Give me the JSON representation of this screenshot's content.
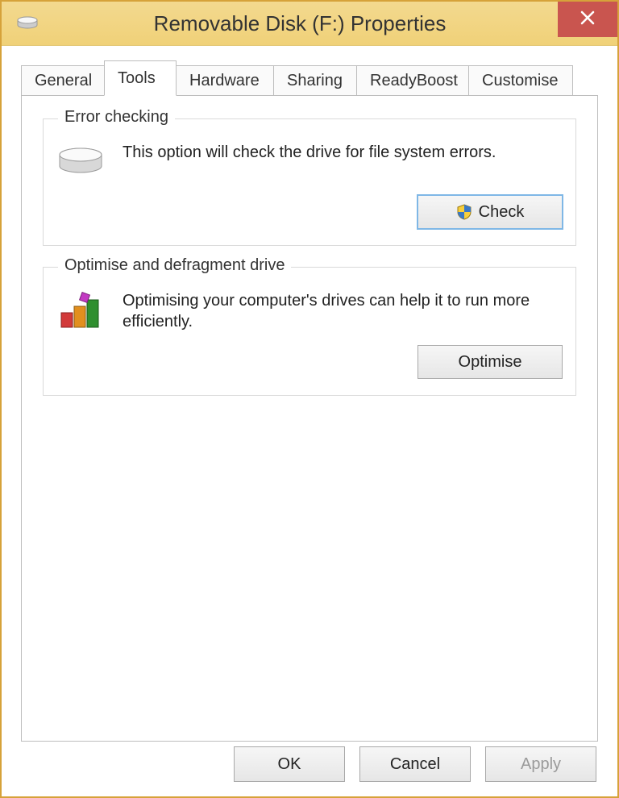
{
  "window": {
    "title": "Removable Disk (F:) Properties"
  },
  "tabs": {
    "general": "General",
    "tools": "Tools",
    "hardware": "Hardware",
    "sharing": "Sharing",
    "readyboost": "ReadyBoost",
    "customise": "Customise"
  },
  "group_error": {
    "legend": "Error checking",
    "desc": "This option will check the drive for file system errors.",
    "button": "Check"
  },
  "group_defrag": {
    "legend": "Optimise and defragment drive",
    "desc": "Optimising your computer's drives can help it to run more efficiently.",
    "button": "Optimise"
  },
  "footer": {
    "ok": "OK",
    "cancel": "Cancel",
    "apply": "Apply"
  }
}
